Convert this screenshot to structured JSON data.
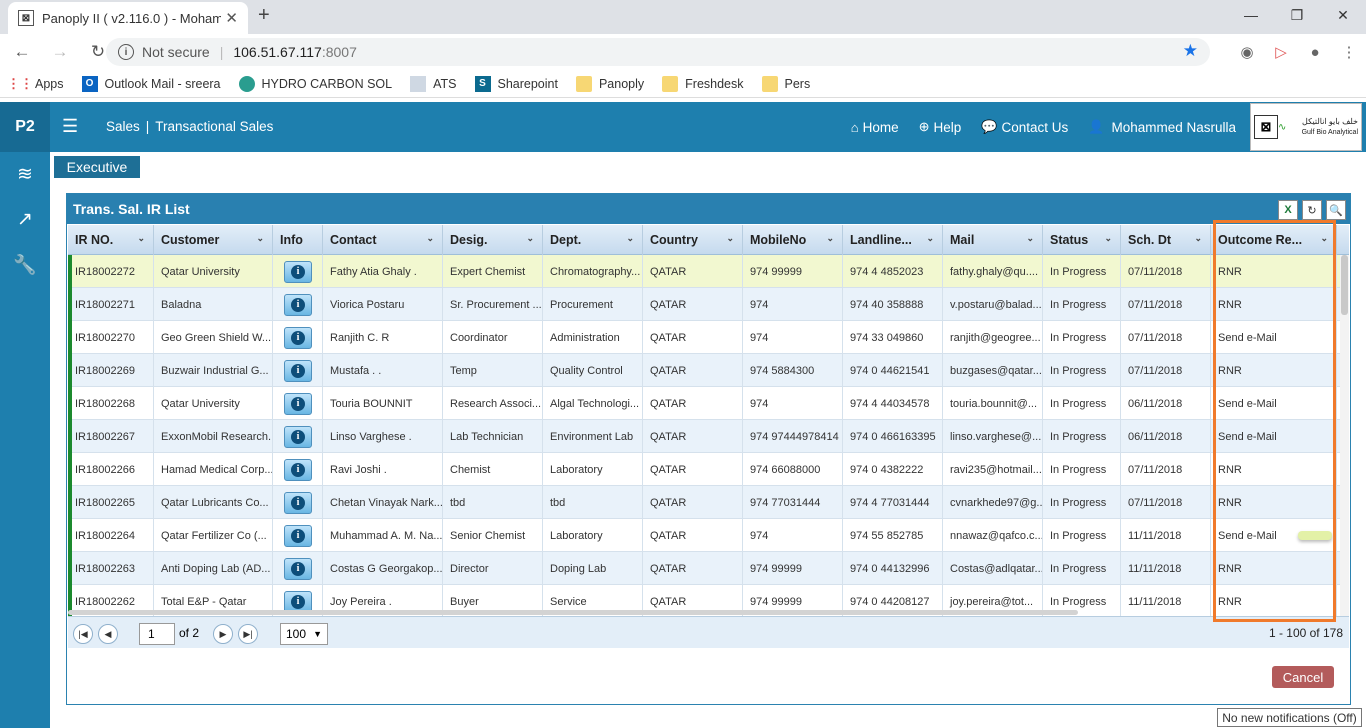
{
  "browser": {
    "tab_title": "Panoply II ( v2.116.0 ) - Mohamm",
    "not_secure": "Not secure",
    "url_host": "106.51.67.117",
    "url_port": ":8007",
    "bookmarks": [
      {
        "label": "Apps",
        "icon": "apps-grid-icon"
      },
      {
        "label": "Outlook Mail - sreera",
        "icon": "outlook-icon"
      },
      {
        "label": "HYDRO CARBON SOL",
        "icon": "globe-icon"
      },
      {
        "label": "ATS",
        "icon": "page-icon"
      },
      {
        "label": "Sharepoint",
        "icon": "sharepoint-icon"
      },
      {
        "label": "Panoply",
        "icon": "folder-icon"
      },
      {
        "label": "Freshdesk",
        "icon": "folder-icon"
      },
      {
        "label": "Pers",
        "icon": "folder-icon"
      }
    ]
  },
  "app": {
    "brand": "P2",
    "breadcrumb_module": "Sales",
    "breadcrumb_page": "Transactional Sales",
    "nav": {
      "home": "Home",
      "help": "Help",
      "contact": "Contact Us",
      "user": "Mohammed Nasrulla"
    },
    "logo_arabic": "خلف بايو انالتيكل",
    "logo_text": "Gulf Bio Analytical",
    "role_button": "Executive"
  },
  "panel": {
    "title": "Trans. Sal. IR List",
    "columns": [
      "IR NO.",
      "Customer",
      "Info",
      "Contact",
      "Desig.",
      "Dept.",
      "Country",
      "MobileNo",
      "Landline...",
      "Mail",
      "Status",
      "Sch. Dt",
      "Outcome Re..."
    ],
    "rows": [
      {
        "ir": "IR18002272",
        "customer": "Qatar University",
        "contact": "Fathy Atia Ghaly .",
        "desig": "Expert Chemist",
        "dept": "Chromatography...",
        "country": "QATAR",
        "mobile": "974 99999",
        "landline": "974 4 4852023",
        "mail": "fathy.ghaly@qu....",
        "status": "In Progress",
        "sch": "07/11/2018",
        "outcome": "RNR"
      },
      {
        "ir": "IR18002271",
        "customer": "Baladna",
        "contact": "Viorica Postaru",
        "desig": "Sr. Procurement ...",
        "dept": "Procurement",
        "country": "QATAR",
        "mobile": "974",
        "landline": "974 40 358888",
        "mail": "v.postaru@balad...",
        "status": "In Progress",
        "sch": "07/11/2018",
        "outcome": "RNR"
      },
      {
        "ir": "IR18002270",
        "customer": "Geo Green Shield W....",
        "contact": "Ranjith C. R",
        "desig": "Coordinator",
        "dept": "Administration",
        "country": "QATAR",
        "mobile": "974",
        "landline": "974 33 049860",
        "mail": "ranjith@geogree...",
        "status": "In Progress",
        "sch": "07/11/2018",
        "outcome": "Send e-Mail"
      },
      {
        "ir": "IR18002269",
        "customer": "Buzwair Industrial G...",
        "contact": "Mustafa . .",
        "desig": "Temp",
        "dept": "Quality Control",
        "country": "QATAR",
        "mobile": "974 5884300",
        "landline": "974 0 44621541",
        "mail": "buzgases@qatar....",
        "status": "In Progress",
        "sch": "07/11/2018",
        "outcome": "RNR"
      },
      {
        "ir": "IR18002268",
        "customer": "Qatar University",
        "contact": "Touria BOUNNIT",
        "desig": "Research Associ...",
        "dept": "Algal Technologi...",
        "country": "QATAR",
        "mobile": "974",
        "landline": "974 4 44034578",
        "mail": "touria.bounnit@...",
        "status": "In Progress",
        "sch": "06/11/2018",
        "outcome": "Send e-Mail"
      },
      {
        "ir": "IR18002267",
        "customer": "ExxonMobil Research...",
        "contact": "Linso Varghese .",
        "desig": "Lab Technician",
        "dept": "Environment Lab",
        "country": "QATAR",
        "mobile": "974 97444978414",
        "landline": "974 0 466163395",
        "mail": "linso.varghese@...",
        "status": "In Progress",
        "sch": "06/11/2018",
        "outcome": "Send e-Mail"
      },
      {
        "ir": "IR18002266",
        "customer": "Hamad Medical Corp...",
        "contact": "Ravi Joshi .",
        "desig": "Chemist",
        "dept": "Laboratory",
        "country": "QATAR",
        "mobile": "974 66088000",
        "landline": "974 0 4382222",
        "mail": "ravi235@hotmail....",
        "status": "In Progress",
        "sch": "07/11/2018",
        "outcome": "RNR"
      },
      {
        "ir": "IR18002265",
        "customer": "Qatar Lubricants Co...",
        "contact": "Chetan Vinayak Nark...",
        "desig": "tbd",
        "dept": "tbd",
        "country": "QATAR",
        "mobile": "974 77031444",
        "landline": "974 4 77031444",
        "mail": "cvnarkhede97@g...",
        "status": "In Progress",
        "sch": "07/11/2018",
        "outcome": "RNR"
      },
      {
        "ir": "IR18002264",
        "customer": "Qatar Fertilizer Co (...",
        "contact": "Muhammad A. M. Na...",
        "desig": "Senior Chemist",
        "dept": "Laboratory",
        "country": "QATAR",
        "mobile": "974",
        "landline": "974 55 852785",
        "mail": "nnawaz@qafco.c...",
        "status": "In Progress",
        "sch": "11/11/2018",
        "outcome": "Send e-Mail"
      },
      {
        "ir": "IR18002263",
        "customer": "Anti Doping Lab (AD...",
        "contact": "Costas G Georgakop...",
        "desig": "Director",
        "dept": "Doping Lab",
        "country": "QATAR",
        "mobile": "974 99999",
        "landline": "974 0 44132996",
        "mail": "Costas@adlqatar....",
        "status": "In Progress",
        "sch": "11/11/2018",
        "outcome": "RNR"
      },
      {
        "ir": "IR18002262",
        "customer": "Total E&P - Qatar",
        "contact": "Joy Pereira .",
        "desig": "Buyer",
        "dept": "Service",
        "country": "QATAR",
        "mobile": "974 99999",
        "landline": "974 0 44208127",
        "mail": "joy.pereira@tot...",
        "status": "In Progress",
        "sch": "11/11/2018",
        "outcome": "RNR"
      }
    ],
    "info_glyph": "i",
    "pager": {
      "page": "1",
      "of": "of 2",
      "size": "100",
      "range": "1 - 100 of 178"
    },
    "cancel": "Cancel"
  },
  "notification": "No new notifications (Off)",
  "colors": {
    "appbar": "#1e7fae",
    "highlight_box": "#f07a2c",
    "cancel": "#b35b5b"
  }
}
